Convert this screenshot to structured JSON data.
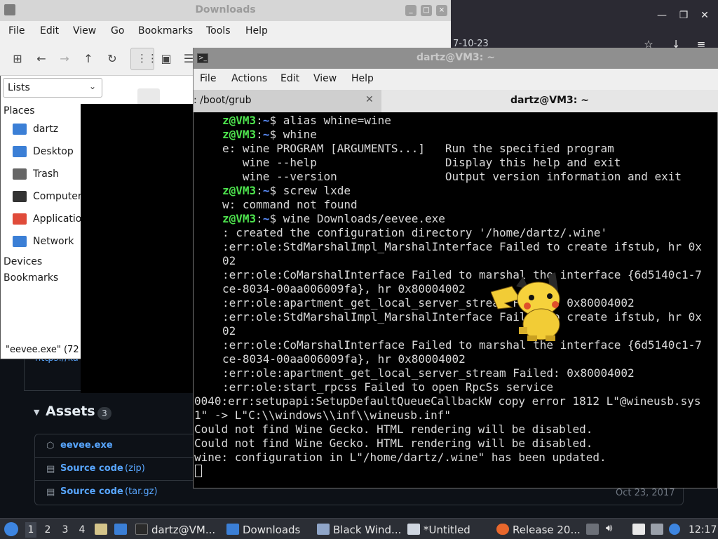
{
  "browser": {
    "date_fragment": "7-10-23",
    "link_fragment": "https://ka",
    "controls": {
      "close": "✕",
      "maximize": "❐",
      "minimize": "—"
    },
    "assets": {
      "title": "Assets",
      "count": "3",
      "items": [
        {
          "icon": "package-icon",
          "name": "eevee.exe",
          "ext": ""
        },
        {
          "icon": "zip-icon",
          "name": "Source code",
          "ext": "(zip)"
        },
        {
          "icon": "zip-icon",
          "name": "Source code",
          "ext": "(tar.gz)"
        }
      ],
      "date": "Oct 23, 2017"
    }
  },
  "file_manager": {
    "title": "Downloads",
    "menu": [
      "File",
      "Edit",
      "View",
      "Go",
      "Bookmarks",
      "Tools",
      "Help"
    ],
    "view_select": "Lists",
    "places_label": "Places",
    "places": [
      {
        "label": "dartz",
        "icon": "folder-icon",
        "color": "#3b7fd6"
      },
      {
        "label": "Desktop",
        "icon": "desktop-icon",
        "color": "#3b7fd6"
      },
      {
        "label": "Trash",
        "icon": "trash-icon",
        "color": "#666666"
      },
      {
        "label": "Computer",
        "icon": "computer-icon",
        "color": "#333333"
      },
      {
        "label": "Applicatio",
        "icon": "applications-icon",
        "color": "#e04b3a"
      },
      {
        "label": "Network",
        "icon": "network-icon",
        "color": "#3b7fd6"
      }
    ],
    "devices_label": "Devices",
    "bookmarks_label": "Bookmarks",
    "status": "\"eevee.exe\" (72"
  },
  "terminal": {
    "title": "dartz@VM3: ~",
    "menu": [
      "File",
      "Actions",
      "Edit",
      "View",
      "Help"
    ],
    "tabs": [
      {
        "label": ": /boot/grub"
      },
      {
        "label": "dartz@VM3: ~"
      }
    ],
    "lines": [
      {
        "prompt_user": "z@VM3",
        "prompt_path": "~",
        "cmd": "$ alias whine=wine"
      },
      {
        "prompt_user": "z@VM3",
        "prompt_path": "~",
        "cmd": "$ whine"
      },
      {
        "text": "e: wine PROGRAM [ARGUMENTS...]   Run the specified program"
      },
      {
        "text": "   wine --help                   Display this help and exit"
      },
      {
        "text": "   wine --version                Output version information and exit"
      },
      {
        "prompt_user": "z@VM3",
        "prompt_path": "~",
        "cmd": "$ screw lxde"
      },
      {
        "text": "w: command not found"
      },
      {
        "prompt_user": "z@VM3",
        "prompt_path": "~",
        "cmd": "$ wine Downloads/eevee.exe"
      },
      {
        "text": ": created the configuration directory '/home/dartz/.wine'"
      },
      {
        "text": ":err:ole:StdMarshalImpl_MarshalInterface Failed to create ifstub, hr 0x"
      },
      {
        "text": "02"
      },
      {
        "text": ":err:ole:CoMarshalInterface Failed to marshal the interface {6d5140c1-7"
      },
      {
        "text": "ce-8034-00aa006009fa}, hr 0x80004002"
      },
      {
        "text": ":err:ole:apartment_get_local_server_stream Failed: 0x80004002"
      },
      {
        "text": ":err:ole:StdMarshalImpl_MarshalInterface Failed to create ifstub, hr 0x"
      },
      {
        "text": "02"
      },
      {
        "text": ":err:ole:CoMarshalInterface Failed to marshal the interface {6d5140c1-7"
      },
      {
        "text": "ce-8034-00aa006009fa}, hr 0x80004002"
      },
      {
        "text": ":err:ole:apartment_get_local_server_stream Failed: 0x80004002"
      },
      {
        "text": ":err:ole:start_rpcss Failed to open RpcSs service"
      },
      {
        "text": "0040:err:setupapi:SetupDefaultQueueCallbackW copy error 1812 L\"@wineusb.sys"
      },
      {
        "text": "1\" -> L\"C:\\\\windows\\\\inf\\\\wineusb.inf\""
      },
      {
        "text": "Could not find Wine Gecko. HTML rendering will be disabled."
      },
      {
        "text": "Could not find Wine Gecko. HTML rendering will be disabled."
      },
      {
        "text": "wine: configuration in L\"/home/dartz/.wine\" has been updated."
      }
    ]
  },
  "taskbar": {
    "workspaces": [
      "1",
      "2",
      "3",
      "4"
    ],
    "active_workspace": "1",
    "tasks": [
      {
        "label": "dartz@VM...",
        "icon": "terminal-icon",
        "color": "#2a2a2a"
      },
      {
        "label": "Downloads",
        "icon": "folder-icon",
        "color": "#3b7fd6"
      },
      {
        "label": "Black Wind...",
        "icon": "window-icon",
        "color": "#8fa5c8"
      },
      {
        "label": "*Untitled",
        "icon": "editor-icon",
        "color": "#cfd6e0"
      },
      {
        "label": "Release 20...",
        "icon": "firefox-icon",
        "color": "#e8672c"
      }
    ],
    "clock": "12:17"
  }
}
